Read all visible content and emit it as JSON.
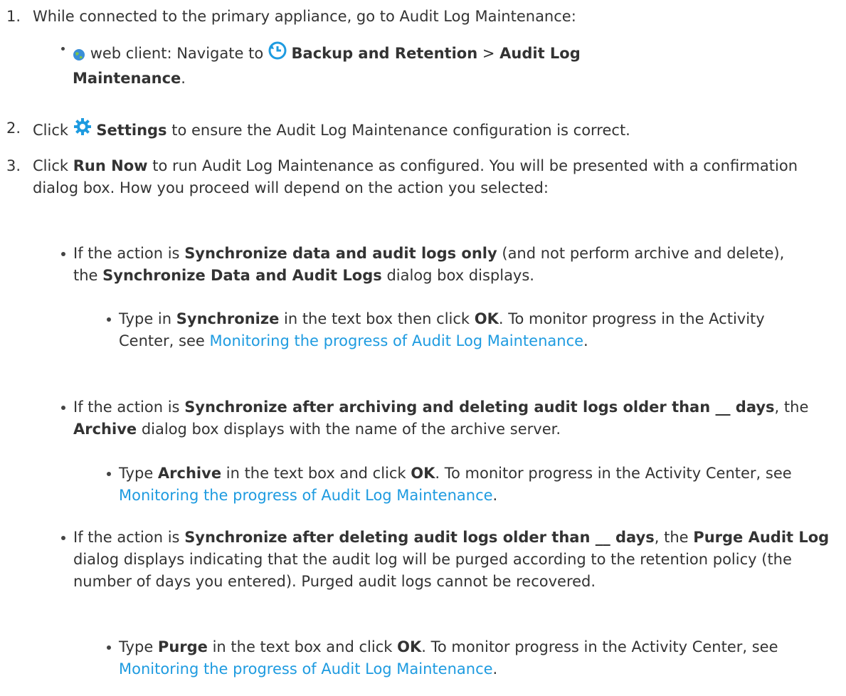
{
  "steps": [
    {
      "num": "1.",
      "text": "While connected to the primary appliance, go to Audit Log Maintenance:"
    },
    {
      "num": "2.",
      "pre": "Click",
      "bold": "Settings",
      "post": "to ensure the Audit Log Maintenance configuration is correct."
    },
    {
      "num": "3.",
      "pre": "Click",
      "bold": "Run Now",
      "post": "to run Audit Log Maintenance as configured. You will be presented with a confirmation dialog box. How you proceed will depend on the action you selected:"
    }
  ],
  "web_client": {
    "label": "web client: Navigate to",
    "path_bold_1": "Backup and Retention",
    "sep": ">",
    "path_bold_2a": "Audit Log",
    "path_bold_2b": "Maintenance",
    "end": "."
  },
  "bullets": [
    {
      "pre": "If the action is",
      "b1": "Synchronize data and audit logs only",
      "mid1": "(and not perform archive and delete), the",
      "b2": "Synchronize Data and Audit Logs",
      "post": "dialog box displays.",
      "sub": {
        "pre": "Type in",
        "b1": "Synchronize",
        "mid": "in the text box then click",
        "b2": "OK",
        "post": ". To monitor progress in the Activity Center, see",
        "link": "Monitoring the progress of Audit Log Maintenance",
        "end": "."
      }
    },
    {
      "pre": "If the action is",
      "b1": "Synchronize after archiving and deleting audit logs older than __ days",
      "mid1": ", the",
      "b2": "Archive",
      "post": "dialog box displays with the name of the archive server.",
      "sub": {
        "pre": "Type",
        "b1": "Archive",
        "mid": "in the text box and click",
        "b2": "OK",
        "post": ". To monitor progress in the Activity Center, see",
        "link": "Monitoring the progress of Audit Log Maintenance",
        "end": "."
      }
    },
    {
      "pre": "If the action is",
      "b1": "Synchronize after deleting audit logs older than __ days",
      "mid1": ", the",
      "b2": "Purge Audit Log",
      "post": "dialog displays indicating that the audit log will be purged according to the retention policy (the number of days you entered). Purged audit logs cannot be recovered.",
      "sub": {
        "pre": "Type",
        "b1": "Purge",
        "mid": "in the text box and click",
        "b2": "OK",
        "post": ". To monitor progress in the Activity Center, see",
        "link": "Monitoring the progress of Audit Log Maintenance",
        "end": "."
      }
    }
  ],
  "colors": {
    "text": "#333333",
    "link": "#1e9be0"
  },
  "icons": [
    "globe-icon",
    "backup-clock-icon",
    "settings-gear-icon"
  ]
}
